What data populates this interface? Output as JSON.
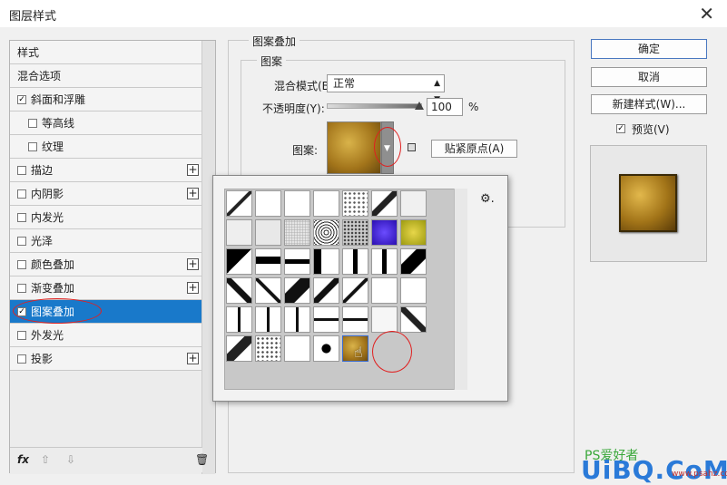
{
  "window": {
    "title": "图层样式",
    "close_glyph": "✕"
  },
  "left_panel": {
    "items": [
      {
        "label": "样式",
        "checkbox": false,
        "checked": false,
        "indent": false,
        "plus": false,
        "selected": false
      },
      {
        "label": "混合选项",
        "checkbox": false,
        "checked": false,
        "indent": false,
        "plus": false,
        "selected": false
      },
      {
        "label": "斜面和浮雕",
        "checkbox": true,
        "checked": true,
        "indent": false,
        "plus": false,
        "selected": false
      },
      {
        "label": "等高线",
        "checkbox": true,
        "checked": false,
        "indent": true,
        "plus": false,
        "selected": false
      },
      {
        "label": "纹理",
        "checkbox": true,
        "checked": false,
        "indent": true,
        "plus": false,
        "selected": false
      },
      {
        "label": "描边",
        "checkbox": true,
        "checked": false,
        "indent": false,
        "plus": true,
        "selected": false
      },
      {
        "label": "内阴影",
        "checkbox": true,
        "checked": false,
        "indent": false,
        "plus": true,
        "selected": false
      },
      {
        "label": "内发光",
        "checkbox": true,
        "checked": false,
        "indent": false,
        "plus": false,
        "selected": false
      },
      {
        "label": "光泽",
        "checkbox": true,
        "checked": false,
        "indent": false,
        "plus": false,
        "selected": false
      },
      {
        "label": "颜色叠加",
        "checkbox": true,
        "checked": false,
        "indent": false,
        "plus": true,
        "selected": false
      },
      {
        "label": "渐变叠加",
        "checkbox": true,
        "checked": false,
        "indent": false,
        "plus": true,
        "selected": false
      },
      {
        "label": "图案叠加",
        "checkbox": true,
        "checked": true,
        "indent": false,
        "plus": false,
        "selected": true
      },
      {
        "label": "外发光",
        "checkbox": true,
        "checked": false,
        "indent": false,
        "plus": false,
        "selected": false
      },
      {
        "label": "投影",
        "checkbox": true,
        "checked": false,
        "indent": false,
        "plus": true,
        "selected": false
      }
    ],
    "bottom": {
      "fx": "fx",
      "up": "⇧",
      "down": "⇩",
      "trash": "🗑"
    }
  },
  "pattern_overlay": {
    "group_title": "图案叠加",
    "sub_title": "图案",
    "blend_mode_label": "混合模式(B):",
    "blend_mode_value": "正常",
    "opacity_label": "不透明度(Y):",
    "opacity_value": "100",
    "opacity_unit": "%",
    "pattern_label": "图案:",
    "snap_origin_button": "贴紧原点(A)"
  },
  "right_buttons": {
    "ok": "确定",
    "cancel": "取消",
    "new_style": "新建样式(W)...",
    "preview_label": "预览(V)",
    "preview_checked": true
  },
  "popup": {
    "gear": "⚙."
  },
  "watermark": {
    "small": "PS爱好者",
    "big": "UiBQ.CoM",
    "site": "www.psahz.com"
  }
}
